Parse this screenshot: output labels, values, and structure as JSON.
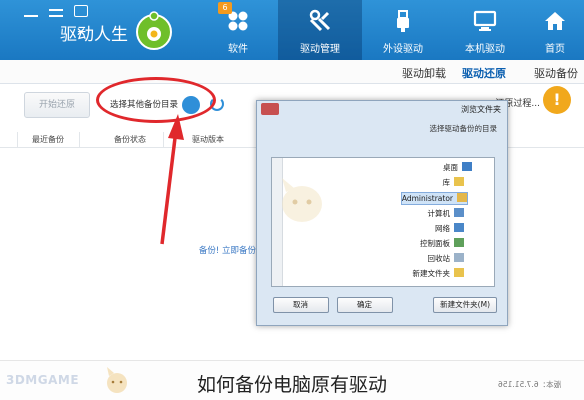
{
  "app": {
    "name": "驱动人生",
    "version_label": "版本：6.7.51.156"
  },
  "header": {
    "tabs": [
      {
        "label": "首页",
        "icon": "home-icon"
      },
      {
        "label": "本机驱动",
        "icon": "monitor-icon"
      },
      {
        "label": "外设驱动",
        "icon": "usb-icon"
      },
      {
        "label": "驱动管理",
        "icon": "wrench-icon",
        "active": true
      },
      {
        "label": "软件",
        "icon": "apps-icon",
        "badge": "6"
      }
    ]
  },
  "subnav": {
    "items": [
      "驱动备份",
      "驱动还原",
      "驱动卸载"
    ],
    "active": "驱动还原"
  },
  "content": {
    "info_text": "还原过程...",
    "restore_button": "开始还原",
    "select_folder": "选择其他备份目录",
    "columns": [
      "驱动版本",
      "备份状态",
      "最近备份"
    ],
    "empty_message": "备份! 立即备份"
  },
  "dialog": {
    "title": "浏览文件夹",
    "description": "选择驱动备份的目录",
    "tree": [
      {
        "label": "桌面",
        "icon": "desktop-folder-icon"
      },
      {
        "label": "库",
        "icon": "library-icon"
      },
      {
        "label": "Administrator",
        "icon": "user-folder-icon",
        "selected": true
      },
      {
        "label": "计算机",
        "icon": "computer-icon"
      },
      {
        "label": "网络",
        "icon": "network-icon"
      },
      {
        "label": "控制面板",
        "icon": "control-panel-icon"
      },
      {
        "label": "回收站",
        "icon": "recycle-bin-icon"
      },
      {
        "label": "新建文件夹",
        "icon": "folder-icon"
      }
    ],
    "buttons": {
      "new_folder": "新建文件夹(M)",
      "ok": "确定",
      "cancel": "取消"
    }
  },
  "caption": {
    "text": "如何备份电脑原有驱动",
    "watermark": "3DMGAME"
  },
  "colors": {
    "header_blue": "#1a78c2",
    "accent_red": "#e0282c",
    "info_orange": "#f1a81c"
  }
}
